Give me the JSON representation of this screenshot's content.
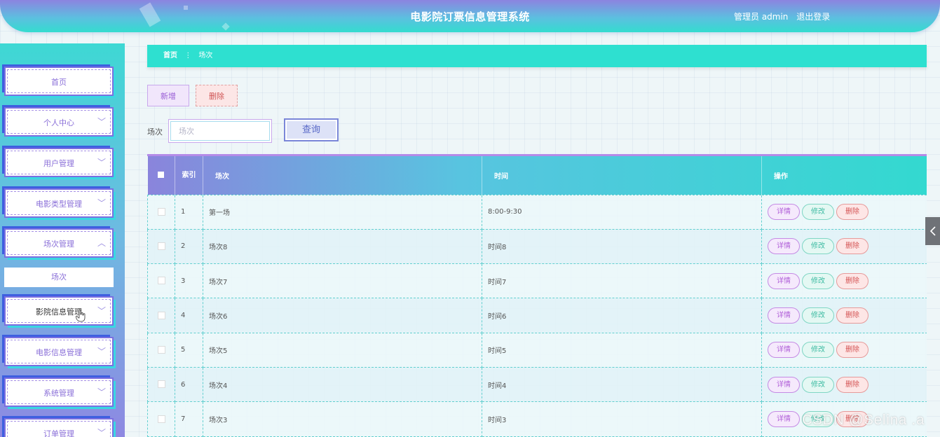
{
  "header": {
    "title": "电影院订票信息管理系统",
    "user": "管理员 admin",
    "logout": "退出登录"
  },
  "sidebar": {
    "items": [
      {
        "label": "首页",
        "has_arrow": false
      },
      {
        "label": "个人中心",
        "has_arrow": true,
        "arrow": "down"
      },
      {
        "label": "用户管理",
        "has_arrow": true,
        "arrow": "down"
      },
      {
        "label": "电影类型管理",
        "has_arrow": true,
        "arrow": "down"
      },
      {
        "label": "场次管理",
        "has_arrow": true,
        "arrow": "up",
        "expanded": true
      },
      {
        "label": "影院信息管理",
        "has_arrow": true,
        "arrow": "down",
        "hovered": true
      },
      {
        "label": "电影信息管理",
        "has_arrow": true,
        "arrow": "down"
      },
      {
        "label": "系统管理",
        "has_arrow": true,
        "arrow": "down"
      },
      {
        "label": "订单管理",
        "has_arrow": true,
        "arrow": "down"
      }
    ],
    "submenu": {
      "label": "场次"
    }
  },
  "breadcrumb": {
    "home": "首页",
    "separator": "⋮",
    "current": "场次"
  },
  "actions": {
    "add": "新增",
    "delete": "删除"
  },
  "search": {
    "label": "场次",
    "placeholder": "场次",
    "button": "查询"
  },
  "table": {
    "headers": {
      "index": "索引",
      "session": "场次",
      "time": "时间",
      "operations": "操作"
    },
    "rows": [
      {
        "index": "1",
        "session": "第一场",
        "time": "8:00-9:30"
      },
      {
        "index": "2",
        "session": "场次8",
        "time": "时间8"
      },
      {
        "index": "3",
        "session": "场次7",
        "time": "时间7"
      },
      {
        "index": "4",
        "session": "场次6",
        "time": "时间6"
      },
      {
        "index": "5",
        "session": "场次5",
        "time": "时间5"
      },
      {
        "index": "6",
        "session": "场次4",
        "time": "时间4"
      },
      {
        "index": "7",
        "session": "场次3",
        "time": "时间3"
      }
    ],
    "row_actions": {
      "detail": "详情",
      "edit": "修改",
      "delete": "删除"
    }
  },
  "watermark": "CSDN @Selina .a",
  "colors": {
    "accent_teal": "#2ee0d0",
    "accent_purple": "#8a84dc",
    "detail": "#b05fd8",
    "edit": "#3fbca3",
    "delete": "#d45454"
  }
}
